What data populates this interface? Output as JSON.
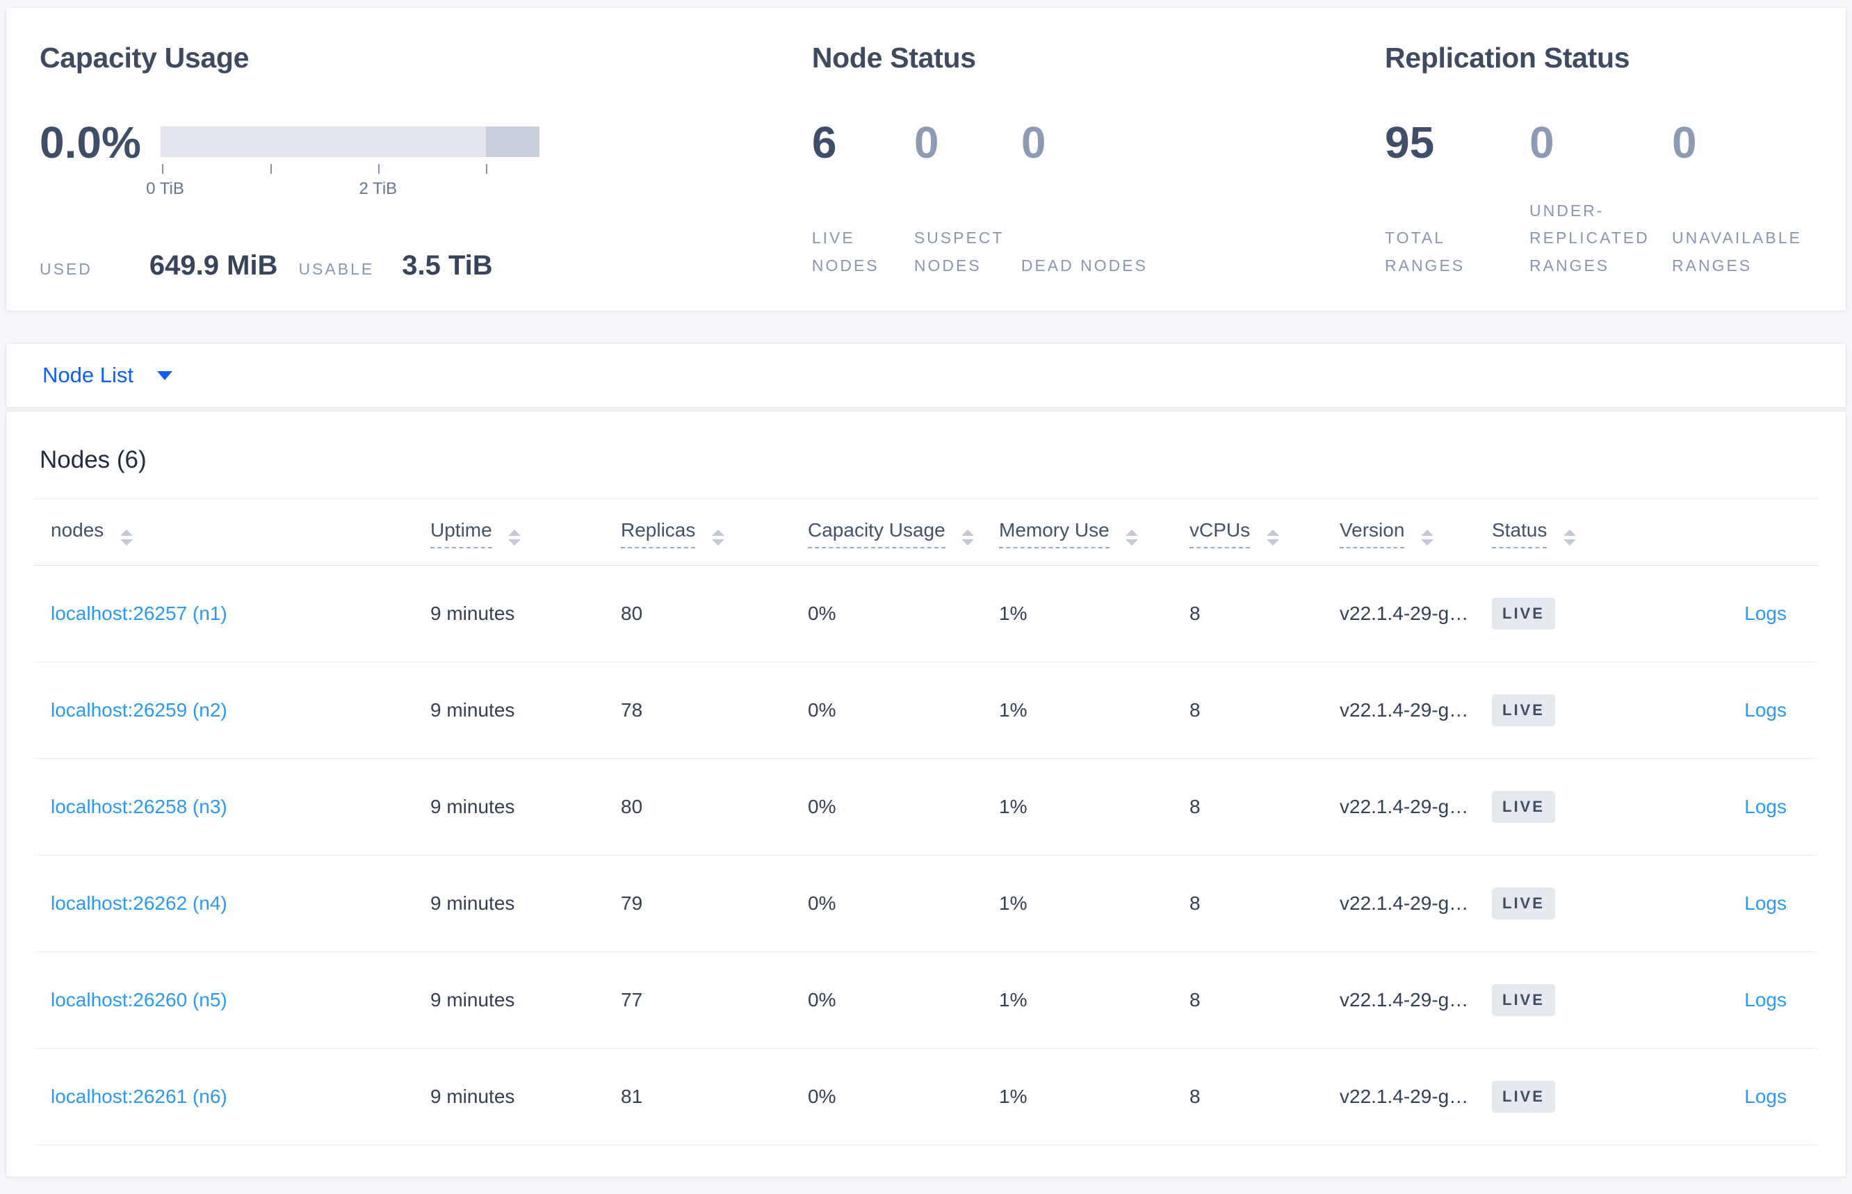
{
  "summary": {
    "capacity": {
      "title": "Capacity Usage",
      "percent": "0.0%",
      "axis_tick_0": "0 TiB",
      "axis_tick_2": "2 TiB",
      "used_label": "USED",
      "used_value": "649.9 MiB",
      "usable_label": "USABLE",
      "usable_value": "3.5 TiB"
    },
    "node_status": {
      "title": "Node Status",
      "stats": [
        {
          "value": "6",
          "label": "LIVE NODES"
        },
        {
          "value": "0",
          "label": "SUSPECT NODES"
        },
        {
          "value": "0",
          "label": "DEAD NODES"
        }
      ]
    },
    "replication_status": {
      "title": "Replication Status",
      "stats": [
        {
          "value": "95",
          "label": "TOTAL RANGES"
        },
        {
          "value": "0",
          "label": "UNDER-REPLICATED RANGES"
        },
        {
          "value": "0",
          "label": "UNAVAILABLE RANGES"
        }
      ]
    }
  },
  "selector": {
    "label": "Node List"
  },
  "nodes_section": {
    "title": "Nodes (6)",
    "columns": [
      {
        "label": "nodes"
      },
      {
        "label": "Uptime"
      },
      {
        "label": "Replicas"
      },
      {
        "label": "Capacity Usage"
      },
      {
        "label": "Memory Use"
      },
      {
        "label": "vCPUs"
      },
      {
        "label": "Version"
      },
      {
        "label": "Status"
      }
    ],
    "rows": [
      {
        "address": "localhost:26257 (n1)",
        "uptime": "9 minutes",
        "replicas": "80",
        "capacity": "0%",
        "memory": "1%",
        "vcpus": "8",
        "version": "v22.1.4-29-g…",
        "status": "LIVE",
        "logs": "Logs"
      },
      {
        "address": "localhost:26259 (n2)",
        "uptime": "9 minutes",
        "replicas": "78",
        "capacity": "0%",
        "memory": "1%",
        "vcpus": "8",
        "version": "v22.1.4-29-g…",
        "status": "LIVE",
        "logs": "Logs"
      },
      {
        "address": "localhost:26258 (n3)",
        "uptime": "9 minutes",
        "replicas": "80",
        "capacity": "0%",
        "memory": "1%",
        "vcpus": "8",
        "version": "v22.1.4-29-g…",
        "status": "LIVE",
        "logs": "Logs"
      },
      {
        "address": "localhost:26262 (n4)",
        "uptime": "9 minutes",
        "replicas": "79",
        "capacity": "0%",
        "memory": "1%",
        "vcpus": "8",
        "version": "v22.1.4-29-g…",
        "status": "LIVE",
        "logs": "Logs"
      },
      {
        "address": "localhost:26260 (n5)",
        "uptime": "9 minutes",
        "replicas": "77",
        "capacity": "0%",
        "memory": "1%",
        "vcpus": "8",
        "version": "v22.1.4-29-g…",
        "status": "LIVE",
        "logs": "Logs"
      },
      {
        "address": "localhost:26261 (n6)",
        "uptime": "9 minutes",
        "replicas": "81",
        "capacity": "0%",
        "memory": "1%",
        "vcpus": "8",
        "version": "v22.1.4-29-g…",
        "status": "LIVE",
        "logs": "Logs"
      }
    ]
  },
  "colors": {
    "accent_blue": "#0d5ef5",
    "link_blue": "#2b99f2",
    "bar_track": "#e3e6ed",
    "bar_end": "#c9cfdb",
    "badge_bg": "#e4e8ef",
    "page_bg": "#f4f6f9"
  }
}
